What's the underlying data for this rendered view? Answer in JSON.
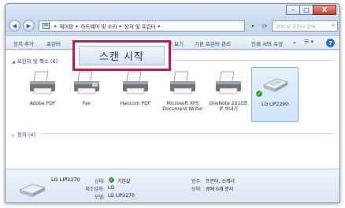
{
  "window": {
    "minimize_glyph": "–",
    "maximize_glyph": "□",
    "close_glyph": "X"
  },
  "address": {
    "back_glyph": "◀",
    "forward_glyph": "▶",
    "crumbs": [
      "제어판",
      "하드웨어 및 소리",
      "장치 및 프린터"
    ],
    "sep": "▸",
    "dropdown_glyph": "▾",
    "refresh_glyph": "⟳",
    "search_placeholder": "장치 및 프린터 검색"
  },
  "toolbar": {
    "add_device": "장치 추가",
    "add_printer": "프린터",
    "see_what_printing": "쇄 보기",
    "set_default": "기본 프린터 관리",
    "print_server": "인쇄 서버 속성",
    "more": "»",
    "view_glyph": "☰ ▾",
    "help_glyph": "?"
  },
  "groups": {
    "printers_fax": "프린터 및 팩스 (6)",
    "devices": "장치 (4)"
  },
  "devices": [
    {
      "label": "Adobe PDF",
      "icon": "printer-icon"
    },
    {
      "label": "Fax",
      "icon": "fax-icon"
    },
    {
      "label": "Hancom PDF",
      "icon": "printer-icon"
    },
    {
      "label": "Microsoft XPS\nDocument Writer",
      "icon": "printer-icon"
    },
    {
      "label": "OneNote 2010로\n로 보내기",
      "icon": "printer-icon"
    },
    {
      "label": "LG LIP2290",
      "icon": "scanner-icon",
      "selected": true
    }
  ],
  "popup": {
    "scan_label": "스캔 시작"
  },
  "details": {
    "name": "LG LIP2270",
    "status_label": "상태:",
    "status_value": "기본값",
    "manufacturer_label": "제조업체:",
    "manufacturer_value": "LG",
    "model_label": "모델:",
    "model_value": "LG LIP2270",
    "category_label": "범주:",
    "category_value": "프린터, 스캐너",
    "queue_label": "상태:",
    "queue_value": "큐에 0개 문서"
  },
  "colors": {
    "highlight_border": "#c2185b",
    "default_check": "#2f9e2f"
  }
}
